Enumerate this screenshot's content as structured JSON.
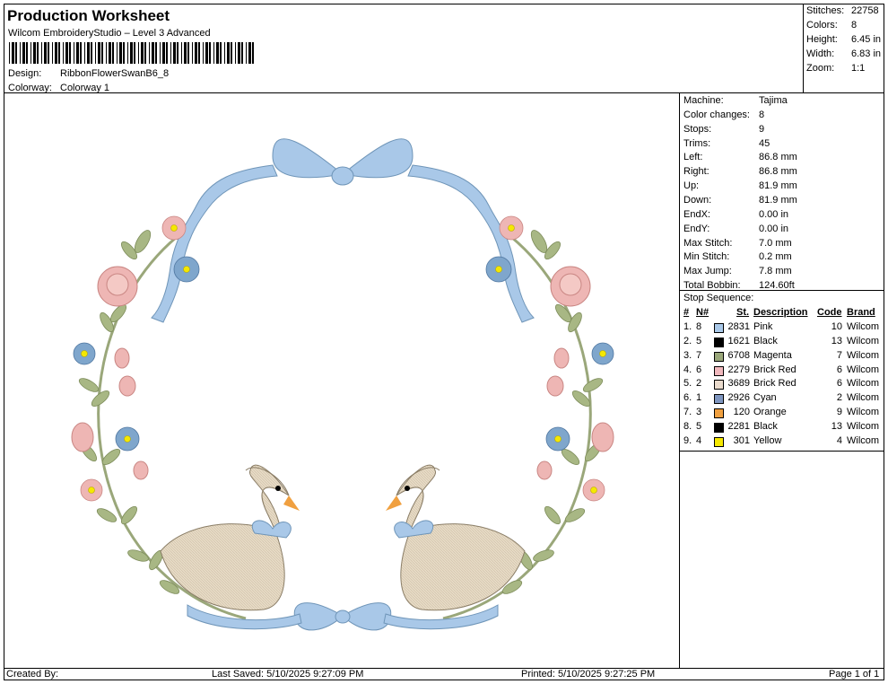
{
  "header": {
    "title": "Production Worksheet",
    "software": "Wilcom EmbroideryStudio – Level 3 Advanced",
    "design_label": "Design:",
    "design_value": "RibbonFlowerSwanB6_8",
    "colorway_label": "Colorway:",
    "colorway_value": "Colorway 1"
  },
  "stats": [
    {
      "label": "Stitches:",
      "value": "22758"
    },
    {
      "label": "Colors:",
      "value": "8"
    },
    {
      "label": "Height:",
      "value": "6.45 in"
    },
    {
      "label": "Width:",
      "value": "6.83 in"
    },
    {
      "label": "Zoom:",
      "value": "1:1"
    }
  ],
  "machine_info": [
    {
      "label": "Machine:",
      "value": "Tajima"
    },
    {
      "label": "Color changes:",
      "value": "8"
    },
    {
      "label": "Stops:",
      "value": "9"
    },
    {
      "label": "Trims:",
      "value": "45"
    },
    {
      "label": "Left:",
      "value": "86.8 mm"
    },
    {
      "label": "Right:",
      "value": "86.8 mm"
    },
    {
      "label": "Up:",
      "value": "81.9 mm"
    },
    {
      "label": "Down:",
      "value": "81.9 mm"
    },
    {
      "label": "EndX:",
      "value": "0.00 in"
    },
    {
      "label": "EndY:",
      "value": "0.00 in"
    },
    {
      "label": "Max Stitch:",
      "value": "7.0 mm"
    },
    {
      "label": "Min Stitch:",
      "value": "0.2 mm"
    },
    {
      "label": "Max Jump:",
      "value": "7.8 mm"
    },
    {
      "label": "Total Bobbin:",
      "value": "124.60ft"
    }
  ],
  "stop_sequence": {
    "title": "Stop Sequence:",
    "headers": {
      "num": "#",
      "n": "N#",
      "st": "St.",
      "desc": "Description",
      "code": "Code",
      "brand": "Brand"
    },
    "rows": [
      {
        "num": "1.",
        "n": "8",
        "color": "#a9c8e8",
        "st": "2831",
        "desc": "Pink",
        "code": "10",
        "brand": "Wilcom"
      },
      {
        "num": "2.",
        "n": "5",
        "color": "#000000",
        "st": "1621",
        "desc": "Black",
        "code": "13",
        "brand": "Wilcom"
      },
      {
        "num": "3.",
        "n": "7",
        "color": "#9aa77a",
        "st": "6708",
        "desc": "Magenta",
        "code": "7",
        "brand": "Wilcom"
      },
      {
        "num": "4.",
        "n": "6",
        "color": "#f0b8bd",
        "st": "2279",
        "desc": "Brick Red",
        "code": "6",
        "brand": "Wilcom"
      },
      {
        "num": "5.",
        "n": "2",
        "color": "#eadbcd",
        "st": "3689",
        "desc": "Brick Red",
        "code": "6",
        "brand": "Wilcom"
      },
      {
        "num": "6.",
        "n": "1",
        "color": "#7f96c0",
        "st": "2926",
        "desc": "Cyan",
        "code": "2",
        "brand": "Wilcom"
      },
      {
        "num": "7.",
        "n": "3",
        "color": "#f0a040",
        "st": "120",
        "desc": "Orange",
        "code": "9",
        "brand": "Wilcom"
      },
      {
        "num": "8.",
        "n": "5",
        "color": "#000000",
        "st": "2281",
        "desc": "Black",
        "code": "13",
        "brand": "Wilcom"
      },
      {
        "num": "9.",
        "n": "4",
        "color": "#f5e800",
        "st": "301",
        "desc": "Yellow",
        "code": "4",
        "brand": "Wilcom"
      }
    ]
  },
  "footer": {
    "created_by": "Created By:",
    "last_saved": "Last Saved: 5/10/2025 9:27:09 PM",
    "printed": "Printed: 5/10/2025 9:27:25 PM",
    "page": "Page 1 of 1"
  },
  "design_colors": {
    "ribbon": "#a9c8e8",
    "ribbon_dark": "#6f95b8",
    "leaf": "#a8b784",
    "leaf_dark": "#7d8c5a",
    "rose": "#eeb6b4",
    "rose_dark": "#c98683",
    "forgetmenot": "#7fa6cc",
    "swan": "#e7dbc6",
    "swan_dark": "#8a7d66",
    "beak": "#f0a040",
    "yellow": "#f5e800"
  }
}
